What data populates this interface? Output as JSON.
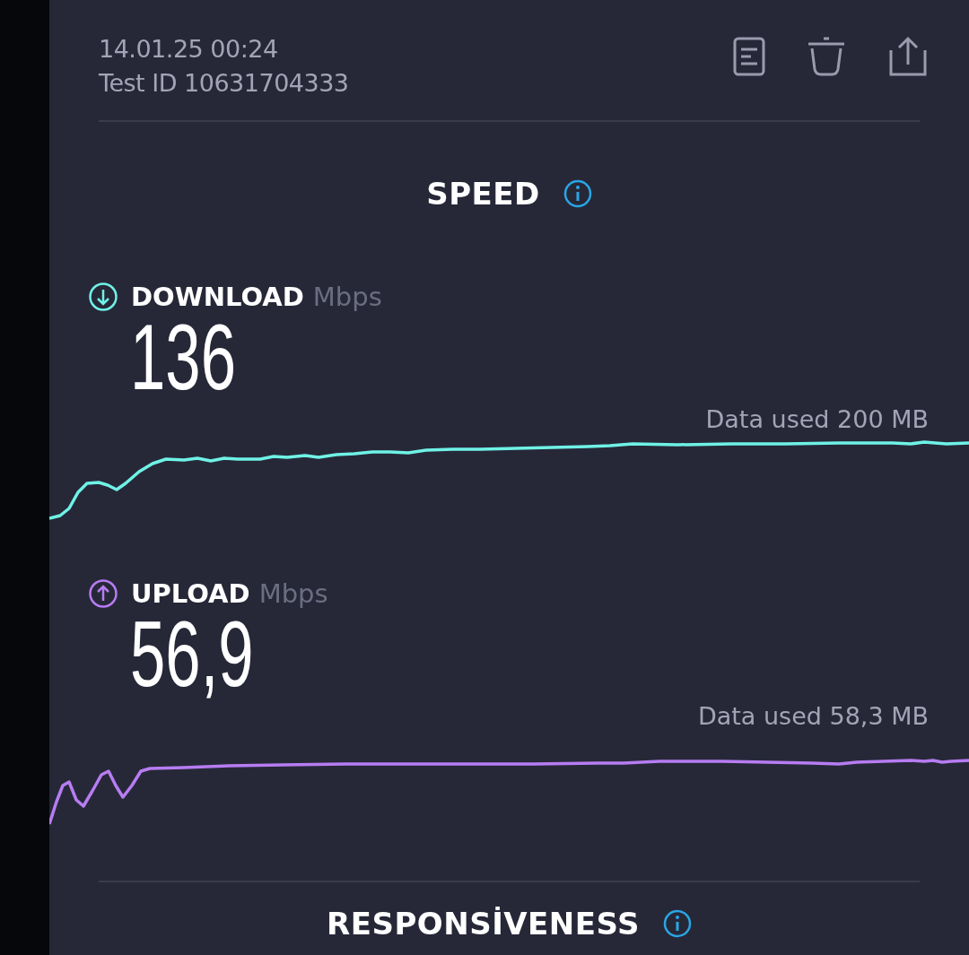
{
  "header": {
    "datetime": "14.01.25 00:24",
    "test_id": "Test ID 10631704333"
  },
  "speed": {
    "title": "SPEED",
    "metrics": [
      {
        "kind": "download",
        "label": "DOWNLOAD",
        "unit": "Mbps",
        "value": "136",
        "data_used": "Data used 200 MB",
        "color": "#6ff2e6"
      },
      {
        "kind": "upload",
        "label": "UPLOAD",
        "unit": "Mbps",
        "value": "56,9",
        "data_used": "Data used 58,3 MB",
        "color": "#b77cf2"
      }
    ]
  },
  "next_section": {
    "title": "RESPONSİVENESS"
  }
}
